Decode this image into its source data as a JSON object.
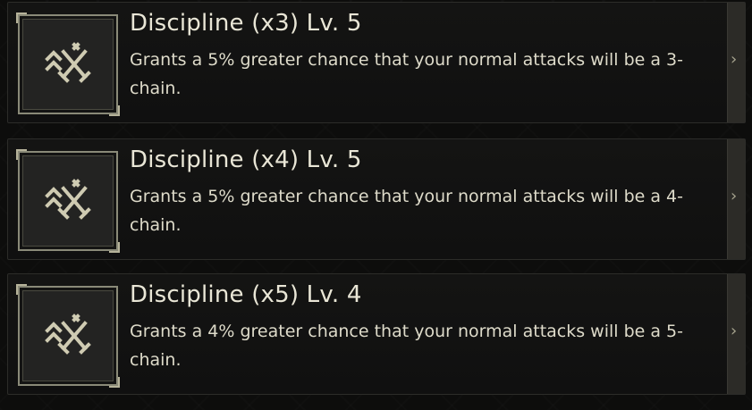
{
  "skills": [
    {
      "title": "Discipline (x3) Lv. 5",
      "description": "Grants a 5% greater chance that your normal attacks will be a 3-chain.",
      "icon": "discipline-swords-icon",
      "expand_icon": "chevron-right-icon"
    },
    {
      "title": "Discipline (x4) Lv. 5",
      "description": "Grants a 5% greater chance that your normal attacks will be a 4-chain.",
      "icon": "discipline-swords-icon",
      "expand_icon": "chevron-right-icon"
    },
    {
      "title": "Discipline (x5) Lv. 4",
      "description": "Grants a 4% greater chance that your normal attacks will be a 5-chain.",
      "icon": "discipline-swords-icon",
      "expand_icon": "chevron-right-icon"
    }
  ],
  "colors": {
    "text": "#e9e6d6",
    "icon": "#cfcbb2",
    "frame": "#8a8a78",
    "panel": "#141413"
  }
}
